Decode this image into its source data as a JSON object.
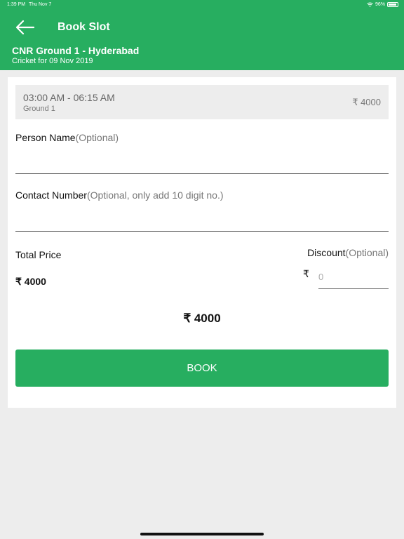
{
  "status_bar": {
    "time": "1:39 PM",
    "date": "Thu Nov 7",
    "battery": "96%"
  },
  "header": {
    "title": "Book Slot",
    "venue": "CNR Ground 1 - Hyderabad",
    "subtitle": "Cricket for 09 Nov 2019",
    "back_icon": "arrow-left-icon"
  },
  "slot": {
    "time": "03:00 AM - 06:15 AM",
    "ground": "Ground 1",
    "price": "₹ 4000"
  },
  "person_name": {
    "label": "Person Name",
    "optional": "(Optional)",
    "value": ""
  },
  "contact_number": {
    "label": "Contact Number",
    "optional": "(Optional, only add 10 digit no.)",
    "value": ""
  },
  "total_price": {
    "label": "Total Price",
    "value": "₹ 4000"
  },
  "discount": {
    "label": "Discount",
    "optional": "(Optional)",
    "currency": "₹",
    "placeholder": "0"
  },
  "grand_total": "₹ 4000",
  "book_button": "BOOK",
  "colors": {
    "primary": "#27ae60",
    "background": "#ededed"
  }
}
